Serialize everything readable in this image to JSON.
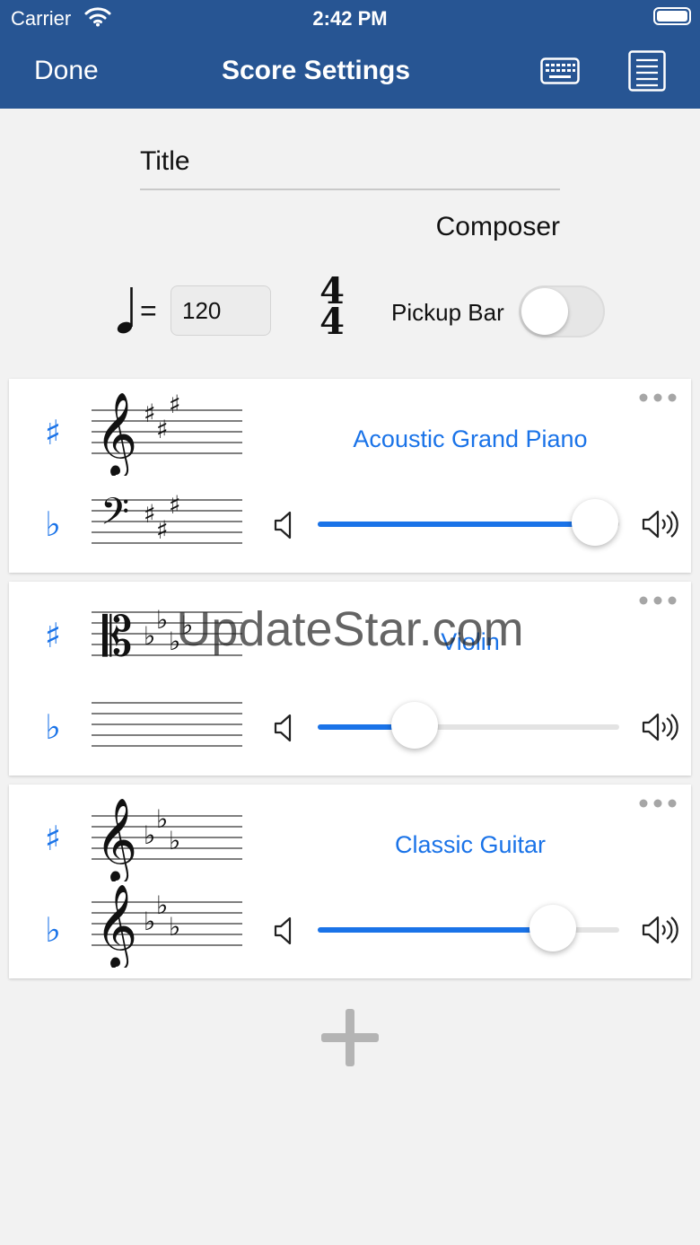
{
  "status_bar": {
    "carrier": "Carrier",
    "time": "2:42 PM",
    "icons": [
      "wifi-icon",
      "battery-icon"
    ]
  },
  "nav": {
    "done_label": "Done",
    "title": "Score Settings",
    "icons": [
      "keyboard-icon",
      "document-icon"
    ]
  },
  "score": {
    "title_placeholder": "Title",
    "composer_placeholder": "Composer",
    "tempo_symbol": "=",
    "tempo": "120",
    "time_signature": {
      "numerator": "4",
      "denominator": "4"
    },
    "pickup_label": "Pickup Bar",
    "pickup_enabled": false
  },
  "instruments": [
    {
      "name": "Acoustic Grand Piano",
      "sharp_symbol": "♯",
      "flat_symbol": "♭",
      "clefs": [
        "treble",
        "bass"
      ],
      "key_signature": "3 sharps",
      "volume": 0.92
    },
    {
      "name": "Violin",
      "sharp_symbol": "♯",
      "flat_symbol": "♭",
      "clefs": [
        "alto",
        "none"
      ],
      "key_signature": "4 flats",
      "volume": 0.32
    },
    {
      "name": "Classic Guitar",
      "sharp_symbol": "♯",
      "flat_symbol": "♭",
      "clefs": [
        "treble",
        "treble"
      ],
      "key_signature": "3 flats",
      "volume": 0.78
    }
  ],
  "colors": {
    "nav_background": "#275593",
    "accent": "#1a73e8",
    "background": "#f2f2f2",
    "track": "#e3e3e3"
  },
  "watermark": "UpdateStar.com",
  "add_icon": "plus-icon"
}
